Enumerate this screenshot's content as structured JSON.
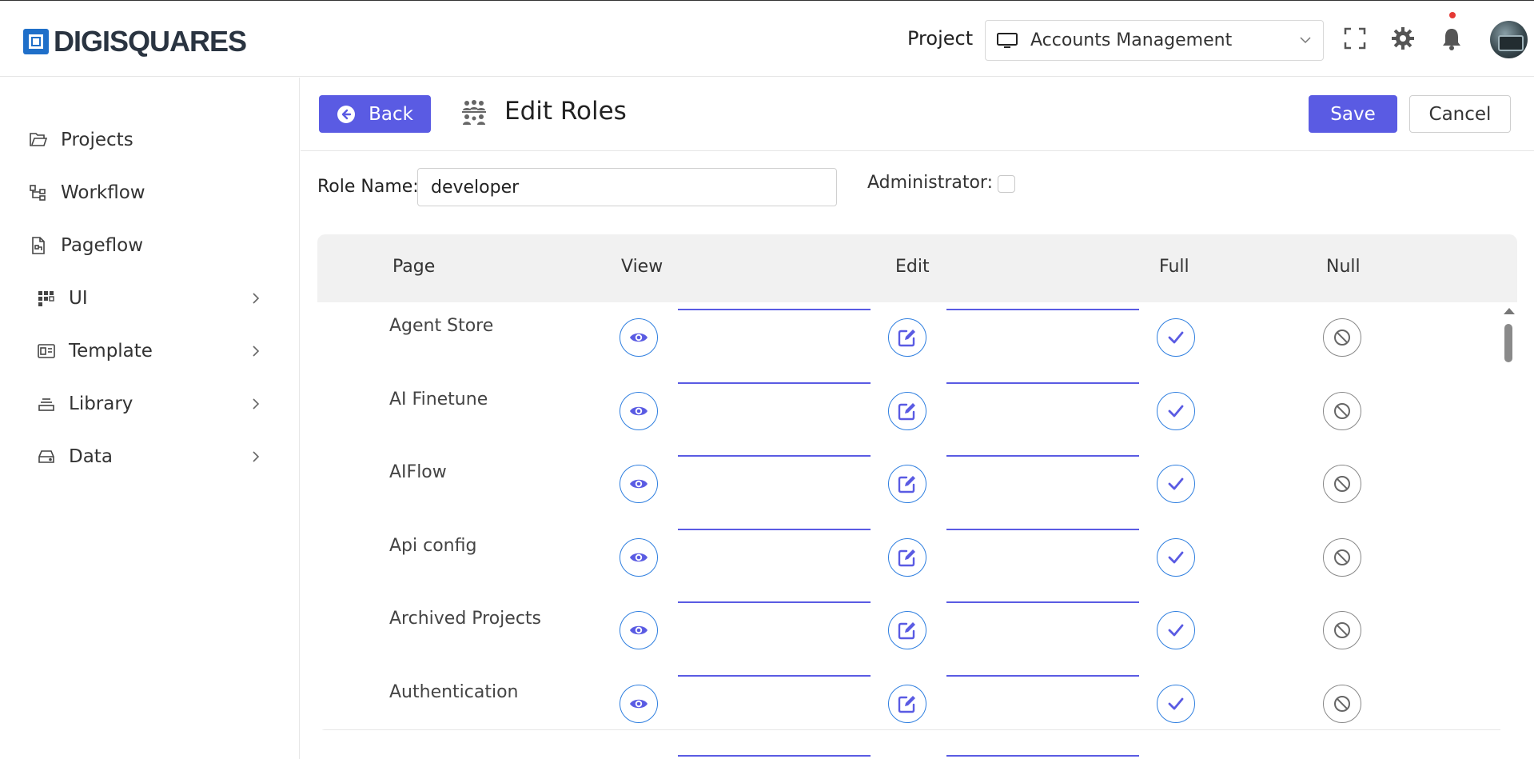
{
  "app": {
    "brand": "DIGISQUARES",
    "project_label": "Project",
    "project_selected": "Accounts Management"
  },
  "sidebar": {
    "items": [
      {
        "label": "Projects",
        "icon": "folder-open-icon",
        "has_submenu": false
      },
      {
        "label": "Workflow",
        "icon": "workflow-icon",
        "has_submenu": false
      },
      {
        "label": "Pageflow",
        "icon": "document-icon",
        "has_submenu": false
      },
      {
        "label": "UI",
        "icon": "grid-icon",
        "has_submenu": true
      },
      {
        "label": "Template",
        "icon": "template-icon",
        "has_submenu": true
      },
      {
        "label": "Library",
        "icon": "library-icon",
        "has_submenu": true
      },
      {
        "label": "Data",
        "icon": "storage-icon",
        "has_submenu": true
      }
    ]
  },
  "header": {
    "back_label": "Back",
    "title": "Edit Roles",
    "save_label": "Save",
    "cancel_label": "Cancel"
  },
  "form": {
    "role_name_label": "Role Name:",
    "role_name_value": "developer",
    "administrator_label": "Administrator:",
    "administrator_checked": false
  },
  "table": {
    "columns": [
      "Page",
      "View",
      "Edit",
      "Full",
      "Null"
    ],
    "rows": [
      {
        "page": "Agent Store"
      },
      {
        "page": "AI Finetune"
      },
      {
        "page": "AIFlow"
      },
      {
        "page": "Api config"
      },
      {
        "page": "Archived Projects"
      },
      {
        "page": "Authentication"
      }
    ]
  },
  "colors": {
    "accent": "#5a5be3",
    "icon_blue": "#5a5be3",
    "circle_border": "#2f7fe0",
    "header_bg": "#f1f1f1"
  }
}
